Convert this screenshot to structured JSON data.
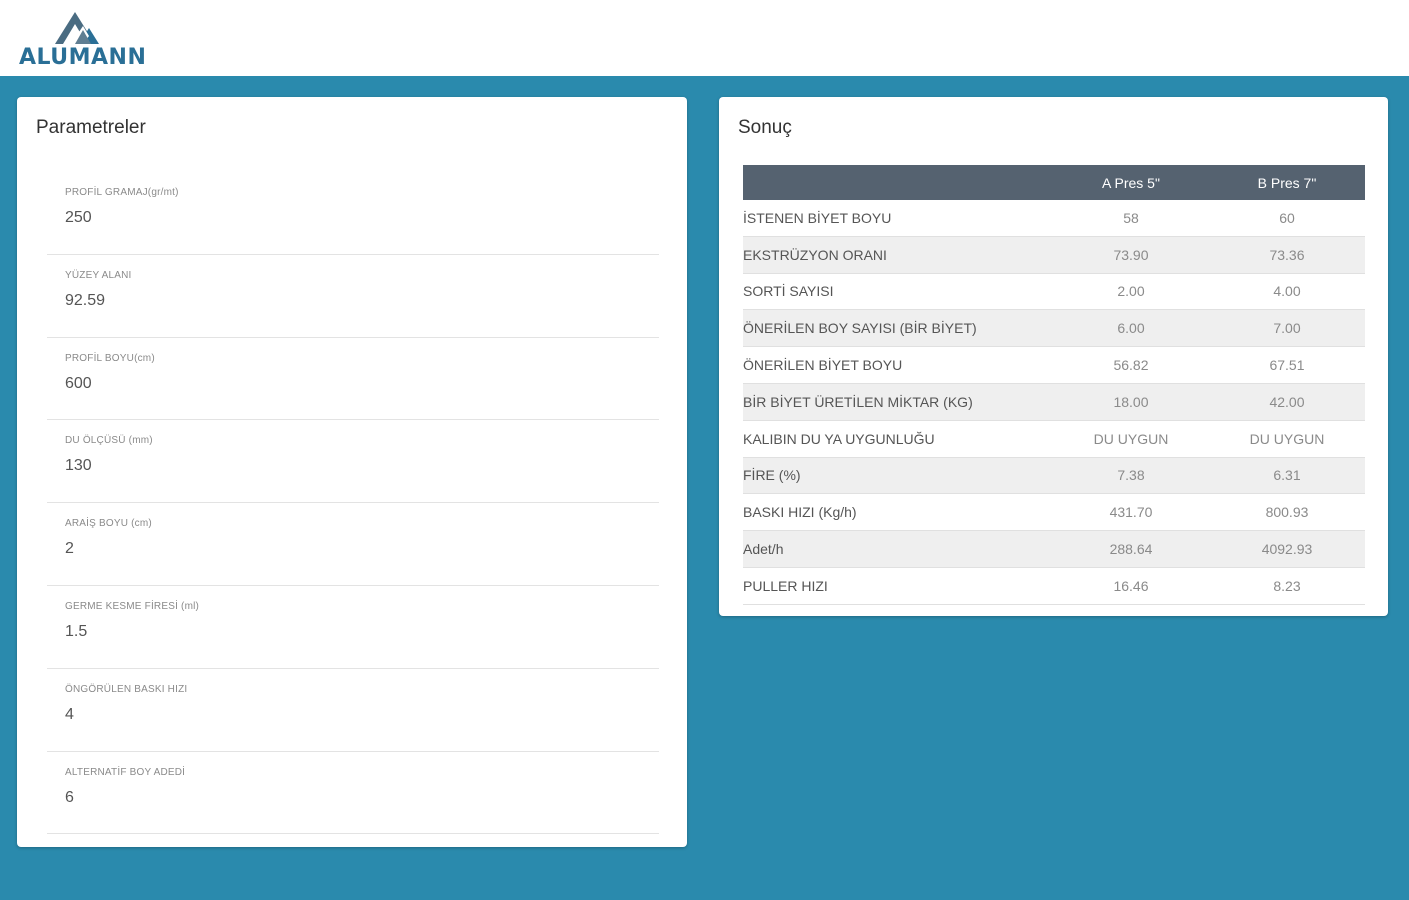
{
  "brand": {
    "logo_text": "ALUMANN",
    "accent_color": "#2a8aad",
    "logo_color": "#2a6f96"
  },
  "parameters": {
    "title": "Parametreler",
    "fields": [
      {
        "label": "PROFİL GRAMAJ(gr/mt)",
        "value": "250"
      },
      {
        "label": "YÜZEY ALANI",
        "value": "92.59"
      },
      {
        "label": "PROFİL BOYU(cm)",
        "value": "600"
      },
      {
        "label": "DU ÖLÇÜSÜ (mm)",
        "value": "130"
      },
      {
        "label": "ARAİŞ BOYU (cm)",
        "value": "2"
      },
      {
        "label": "GERME KESME FİRESİ (ml)",
        "value": "1.5"
      },
      {
        "label": "ÖNGÖRÜLEN BASKI HIZI",
        "value": "4"
      },
      {
        "label": "ALTERNATİF BOY ADEDİ",
        "value": "6"
      }
    ]
  },
  "result": {
    "title": "Sonuç",
    "columns": [
      "",
      "A Pres 5\"",
      "B Pres 7\""
    ],
    "rows": [
      {
        "name": "İSTENEN BİYET BOYU",
        "a": "58",
        "b": "60"
      },
      {
        "name": "EKSTRÜZYON ORANI",
        "a": "73.90",
        "b": "73.36"
      },
      {
        "name": "SORTİ SAYISI",
        "a": "2.00",
        "b": "4.00"
      },
      {
        "name": "ÖNERİLEN BOY SAYISI (BİR BİYET)",
        "a": "6.00",
        "b": "7.00"
      },
      {
        "name": "ÖNERİLEN BİYET BOYU",
        "a": "56.82",
        "b": "67.51"
      },
      {
        "name": "BİR BİYET ÜRETİLEN MİKTAR (KG)",
        "a": "18.00",
        "b": "42.00"
      },
      {
        "name": "KALIBIN DU YA UYGUNLUĞU",
        "a": "DU UYGUN",
        "b": "DU UYGUN"
      },
      {
        "name": "FİRE (%)",
        "a": "7.38",
        "b": "6.31"
      },
      {
        "name": "BASKI HIZI (Kg/h)",
        "a": "431.70",
        "b": "800.93"
      },
      {
        "name": "Adet/h",
        "a": "288.64",
        "b": "4092.93"
      },
      {
        "name": "PULLER HIZI",
        "a": "16.46",
        "b": "8.23"
      }
    ]
  }
}
